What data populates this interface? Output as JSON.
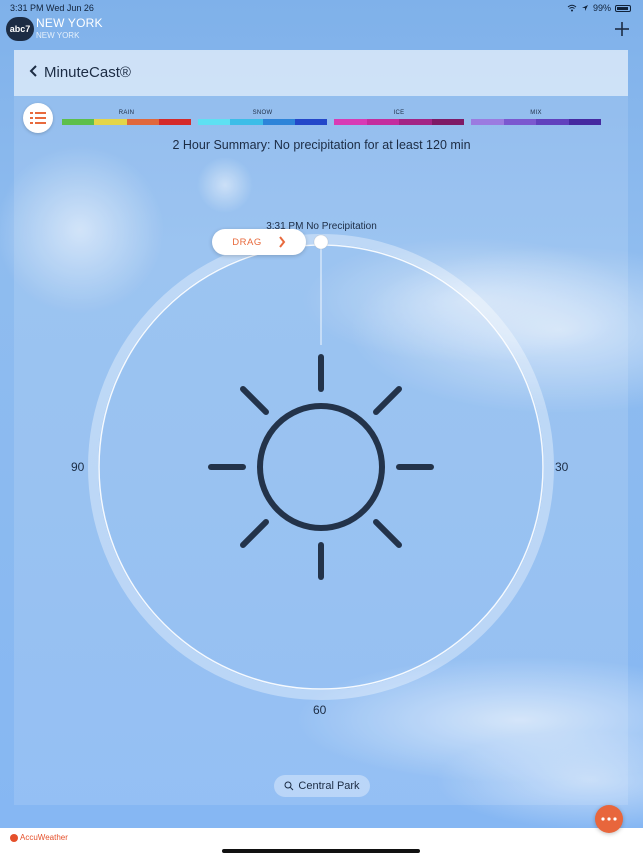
{
  "status_bar": {
    "time": "3:31 PM",
    "date": "Wed Jun 26",
    "battery": "99%"
  },
  "header": {
    "logo_text": "abc7",
    "city": "NEW YORK",
    "city_sub": "NEW YORK",
    "add_icon": "plus-icon"
  },
  "nav": {
    "back_icon": "chevron-left-icon",
    "title": "MinuteCast®"
  },
  "legend": {
    "menu_icon": "list-icon",
    "groups": [
      {
        "label": "RAIN",
        "colors": [
          "#5dbf4b",
          "#e3d54a",
          "#e0683c",
          "#d42a2a"
        ]
      },
      {
        "label": "SNOW",
        "colors": [
          "#5ee0f2",
          "#3cbde8",
          "#2d84d9",
          "#2347c9"
        ]
      },
      {
        "label": "ICE",
        "colors": [
          "#d83bb5",
          "#c42d9e",
          "#a32485",
          "#7e1a66"
        ]
      },
      {
        "label": "MIX",
        "colors": [
          "#9b7be0",
          "#7b58cf",
          "#6141bd",
          "#4529a0"
        ]
      }
    ]
  },
  "summary": "2 Hour Summary: No precipitation for at least 120 min",
  "dial": {
    "time_label": "3:31 PM No Precipitation",
    "drag_label": "DRAG",
    "weather_icon": "sun-icon",
    "labels": {
      "right": "30",
      "bottom": "60",
      "left": "90"
    }
  },
  "search": {
    "icon": "search-icon",
    "text": "Central Park"
  },
  "footer": {
    "brand": "AccuWeather",
    "fab_icon": "more-icon"
  }
}
